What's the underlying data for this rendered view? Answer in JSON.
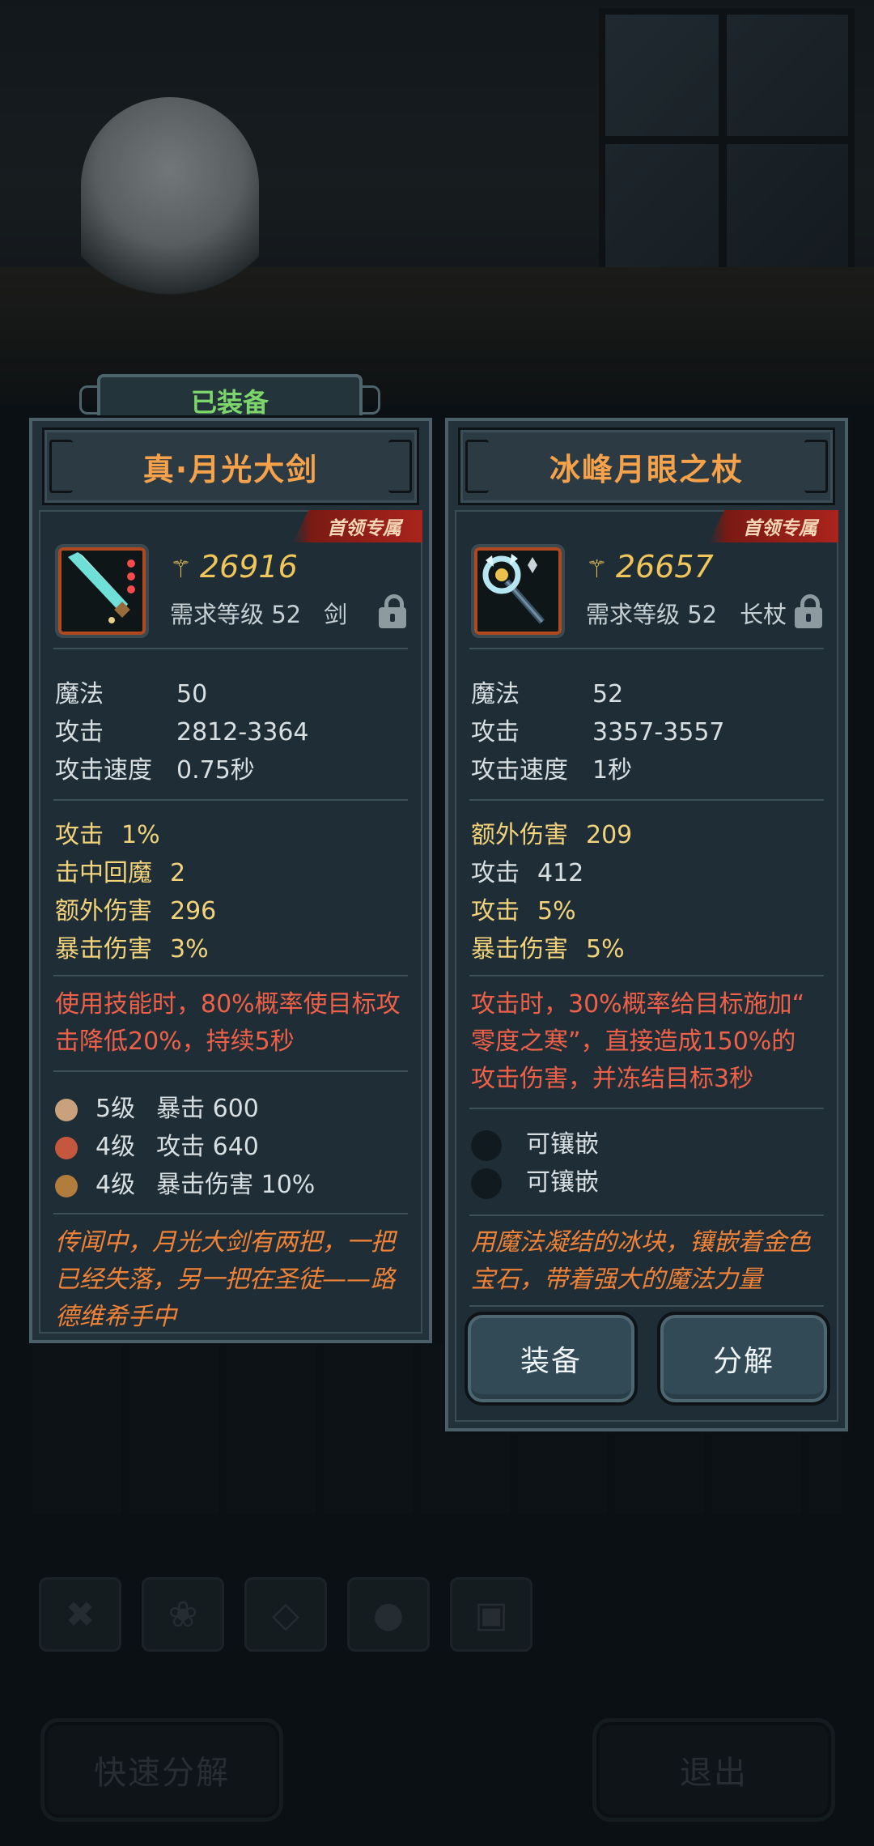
{
  "bottom": {
    "quick_decompose": "快速分解",
    "exit": "退出",
    "slot_icons": [
      "wrench-icon",
      "paw-icon",
      "gem-icon",
      "stones-icon",
      "chest-icon"
    ]
  },
  "left": {
    "equipped_label": "已装备",
    "name": "真·月光大剑",
    "boss_tag": "首领专属",
    "score": "26916",
    "req_level": "需求等级 52",
    "type": "剑",
    "base": [
      {
        "k": "魔法",
        "v": "50"
      },
      {
        "k": "攻击",
        "v": "2812-3364"
      },
      {
        "k": "攻击速度",
        "v": "0.75秒"
      }
    ],
    "attrs": [
      {
        "k": "攻击",
        "v": "1%"
      },
      {
        "k": "击中回魔",
        "v": "2"
      },
      {
        "k": "额外伤害",
        "v": "296"
      },
      {
        "k": "暴击伤害",
        "v": "3%"
      }
    ],
    "skill_lines": [
      "使用技能时，80%概率使目标攻",
      "击降低20%，持续5秒"
    ],
    "gems": [
      {
        "level": "5级",
        "text": "暴击 600",
        "color": "#c9a27d"
      },
      {
        "level": "4级",
        "text": "攻击 640",
        "color": "#c4573e"
      },
      {
        "level": "4级",
        "text": "暴击伤害 10%",
        "color": "#b27c3c"
      }
    ],
    "lore_lines": [
      "传闻中，月光大剑有两把，一把",
      "已经失落，另一把在圣徒——路",
      "德维希手中"
    ]
  },
  "right": {
    "name": "冰峰月眼之杖",
    "boss_tag": "首领专属",
    "score": "26657",
    "req_level": "需求等级 52",
    "type": "长杖",
    "base": [
      {
        "k": "魔法",
        "v": "52"
      },
      {
        "k": "攻击",
        "v": "3357-3557"
      },
      {
        "k": "攻击速度",
        "v": "1秒"
      }
    ],
    "attrs": [
      {
        "k": "额外伤害",
        "v": "209",
        "color": "#f2d27a"
      },
      {
        "k": "攻击",
        "v": "412",
        "color": "#d7dfe3"
      },
      {
        "k": "攻击",
        "v": "5%",
        "color": "#f2d27a"
      },
      {
        "k": "暴击伤害",
        "v": "5%",
        "color": "#f2d27a"
      }
    ],
    "skill_lines": [
      "攻击时，30%概率给目标施加“",
      "零度之寒”，直接造成150%的",
      "攻击伤害，并冻结目标3秒"
    ],
    "sockets": [
      "可镶嵌",
      "可镶嵌"
    ],
    "lore_lines": [
      "用魔法凝结的冰块，镶嵌着金色",
      "宝石，带着强大的魔法力量"
    ],
    "equip_button": "装备",
    "decompose_button": "分解"
  }
}
